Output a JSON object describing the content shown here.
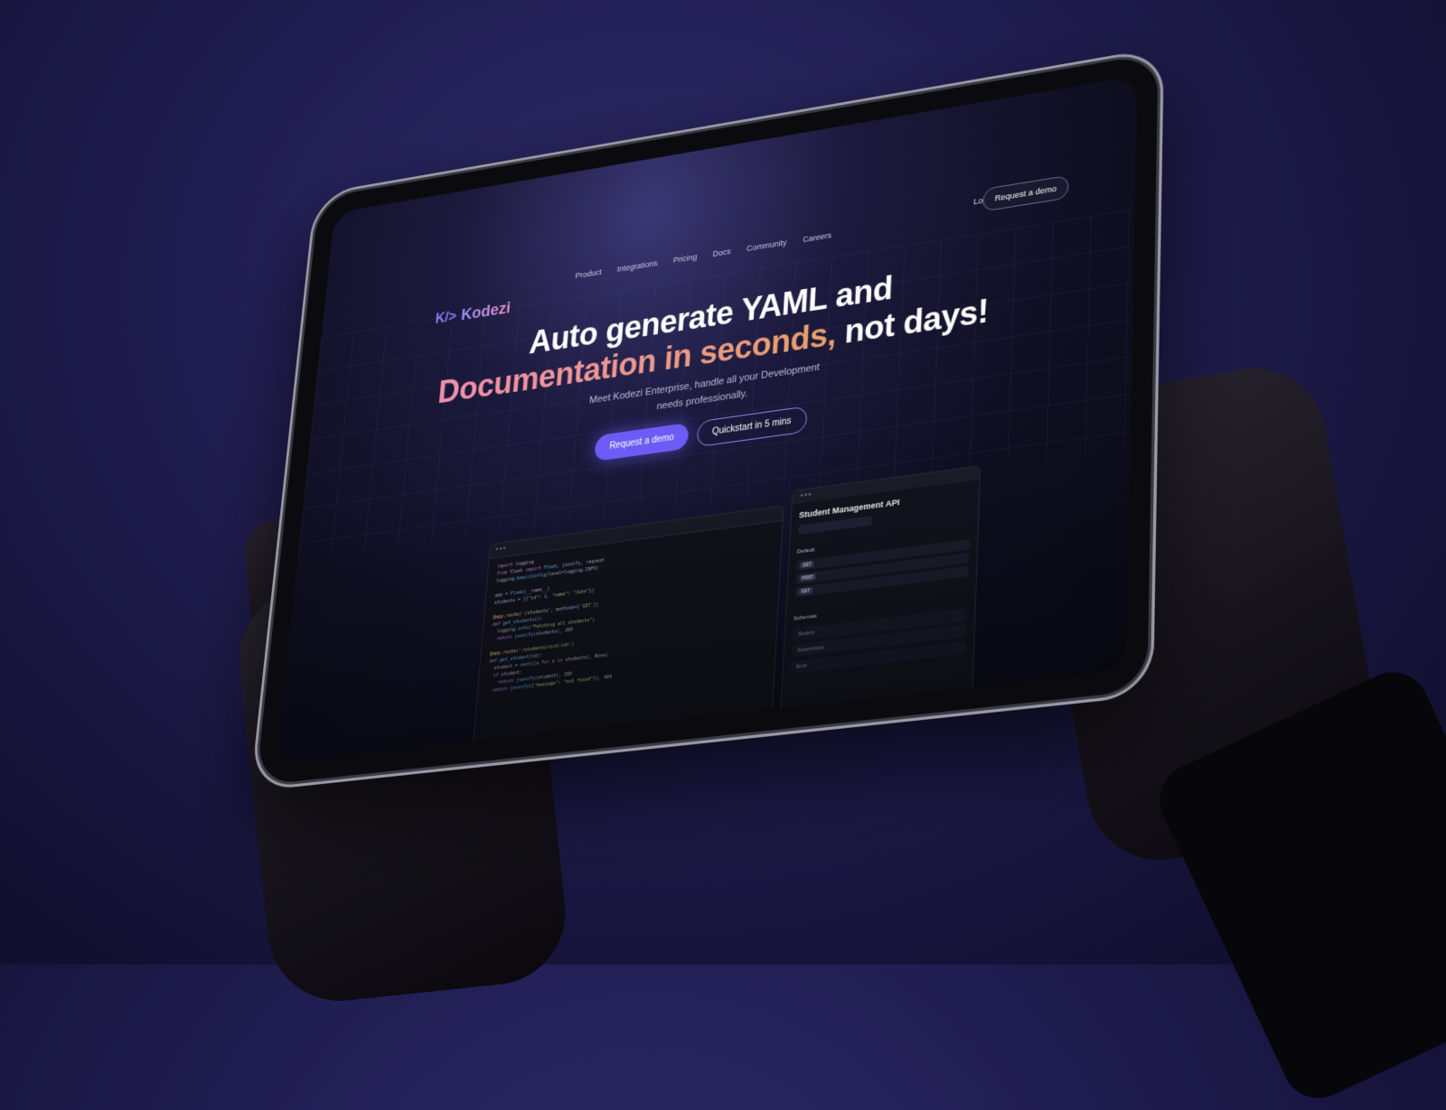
{
  "brand": {
    "name": "Kodezi",
    "mark": "K/>"
  },
  "nav": {
    "items": [
      "Product",
      "Integrations",
      "Pricing",
      "Docs",
      "Community",
      "Careers"
    ]
  },
  "header": {
    "login": "Login",
    "request_demo": "Request a demo"
  },
  "hero": {
    "line1": "Auto generate YAML and",
    "line2_gradient": "Documentation in seconds,",
    "line2_white": " not days!",
    "subtitle_line1": "Meet Kodezi Enterprise, handle all your Development",
    "subtitle_line2": "needs professionally.",
    "cta_primary": "Request a demo",
    "cta_secondary": "Quickstart in 5 mins"
  },
  "api_panel": {
    "title": "Student Management API",
    "default_label": "Default",
    "methods": [
      "GET",
      "POST",
      "GET"
    ],
    "schemas_label": "Schemas",
    "schemas": [
      "Student",
      "StudentInput",
      "Error"
    ]
  },
  "colors": {
    "accent": "#6c5cf5",
    "gradient_start": "#f08fb0",
    "gradient_end": "#e8a06a",
    "bg": "#1c1a3d"
  }
}
